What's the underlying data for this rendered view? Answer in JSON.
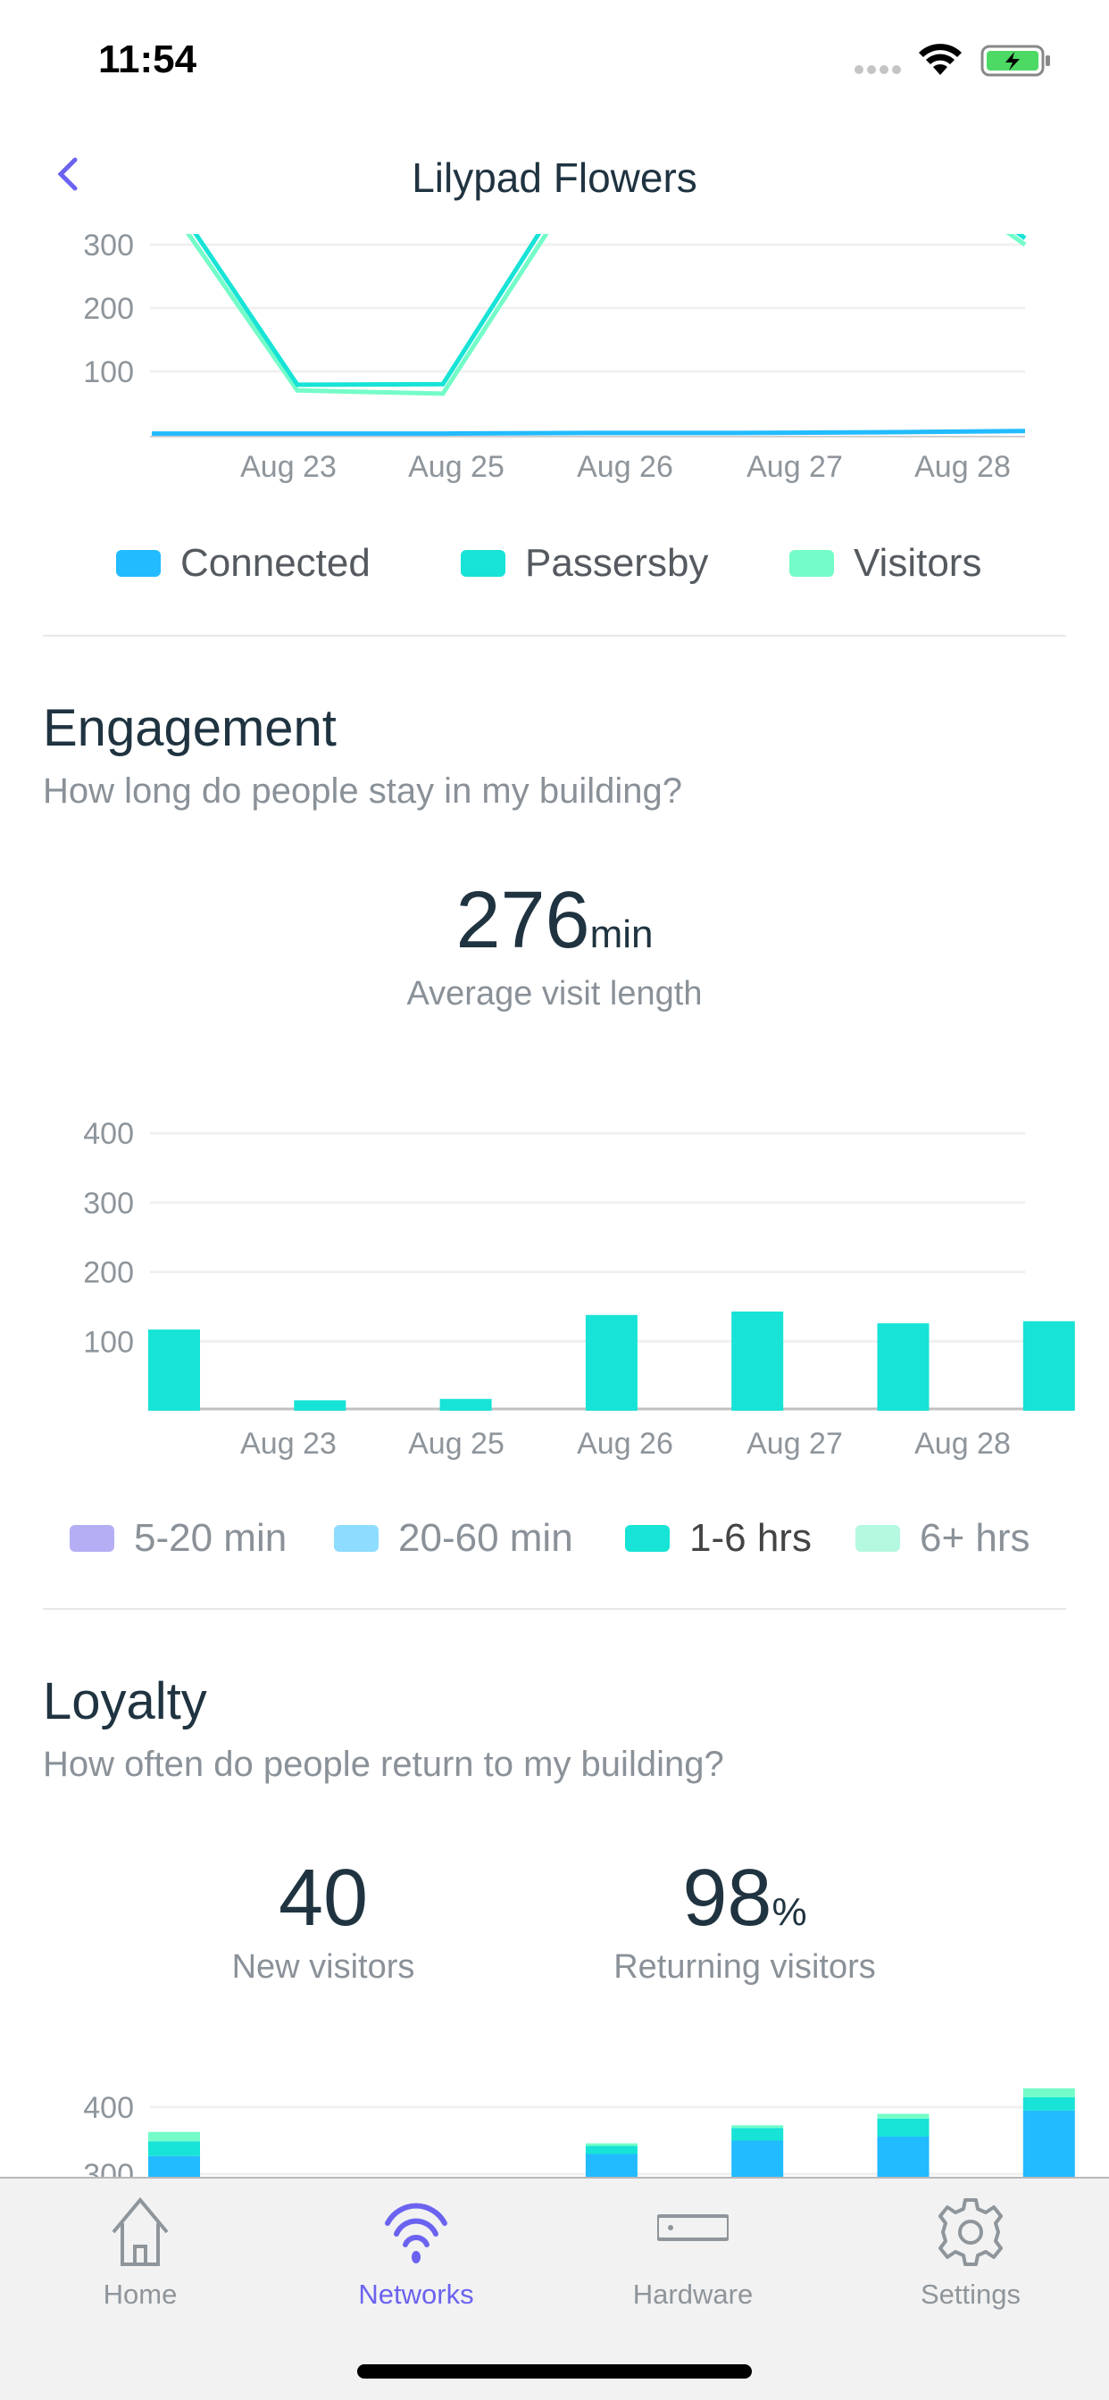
{
  "status": {
    "time": "11:54"
  },
  "header": {
    "title": "Lilypad Flowers"
  },
  "colors": {
    "accent": "#6b63f0",
    "connected": "#22bbff",
    "passersby": "#17e3d6",
    "visitors": "#74fcc8",
    "m5_20": "#b5aef5",
    "m20_60": "#8edcff",
    "h1_6": "#17e3d6",
    "h6plus": "#b4f8e0"
  },
  "traffic": {
    "legend": [
      "Connected",
      "Passersby",
      "Visitors"
    ]
  },
  "engagement": {
    "title": "Engagement",
    "subtitle": "How long do people stay in my building?",
    "value": "276",
    "unit": "min",
    "caption": "Average visit length",
    "legend": [
      "5-20 min",
      "20-60 min",
      "1-6 hrs",
      "6+ hrs"
    ]
  },
  "loyalty": {
    "title": "Loyalty",
    "subtitle": "How often do people return to my building?",
    "new_value": "40",
    "new_caption": "New visitors",
    "ret_value": "98",
    "ret_unit": "%",
    "ret_caption": "Returning visitors"
  },
  "chart_data": [
    {
      "type": "line",
      "x_tick_labels": [
        "Aug 23",
        "Aug 25",
        "Aug 26",
        "Aug 27",
        "Aug 28"
      ],
      "y_ticks": [
        100,
        200,
        300
      ],
      "grid": true,
      "legend_placement": "bottom",
      "series": [
        {
          "name": "Connected",
          "values": [
            2,
            2,
            2,
            3,
            3,
            4,
            6
          ]
        },
        {
          "name": "Passersby",
          "values": [
            420,
            79,
            80,
            440,
            500,
            480,
            310
          ]
        },
        {
          "name": "Visitors",
          "values": [
            400,
            70,
            65,
            420,
            480,
            460,
            300
          ]
        }
      ]
    },
    {
      "type": "bar",
      "x_tick_labels": [
        "Aug 23",
        "Aug 25",
        "Aug 26",
        "Aug 27",
        "Aug 28"
      ],
      "y_ticks": [
        100,
        200,
        300,
        400
      ],
      "ylim": [
        0,
        400
      ],
      "grid": true,
      "legend_placement": "bottom",
      "series": [
        {
          "name": "1-6 hrs",
          "values": [
            117,
            15,
            17,
            138,
            143,
            126,
            129
          ]
        }
      ]
    },
    {
      "type": "bar",
      "stacked": true,
      "y_ticks": [
        300,
        400
      ],
      "grid": true,
      "series": [
        {
          "name": "Connected",
          "values": [
            327,
            null,
            null,
            330,
            350,
            356,
            395
          ]
        },
        {
          "name": "Passersby",
          "values": [
            22,
            null,
            null,
            12,
            19,
            27,
            20
          ]
        },
        {
          "name": "Visitors",
          "values": [
            14,
            null,
            null,
            4,
            4,
            7,
            13
          ]
        }
      ]
    }
  ],
  "tabs": [
    {
      "label": "Home",
      "icon": "house-icon"
    },
    {
      "label": "Networks",
      "icon": "wifi-icon",
      "active": true
    },
    {
      "label": "Hardware",
      "icon": "hardware-icon"
    },
    {
      "label": "Settings",
      "icon": "gear-icon"
    }
  ]
}
